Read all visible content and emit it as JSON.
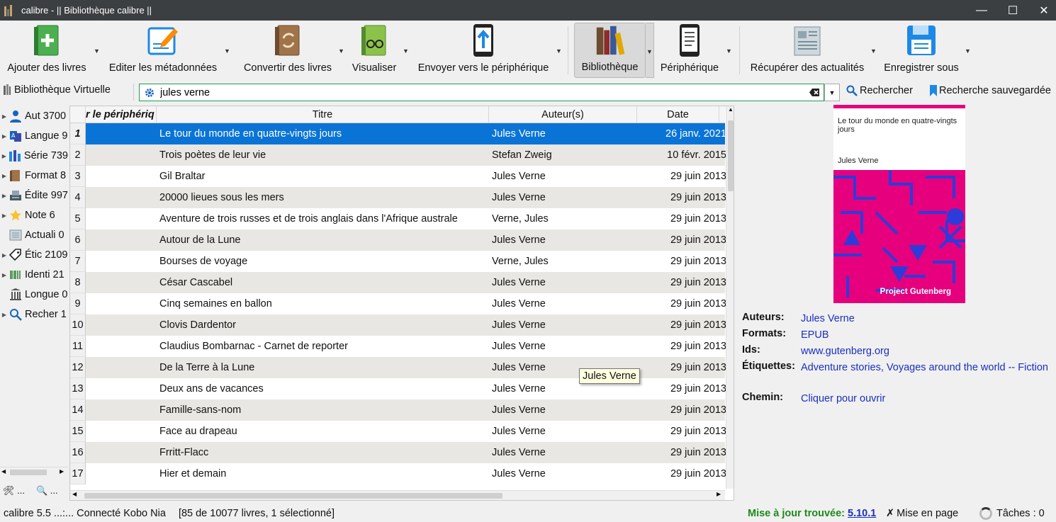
{
  "window": {
    "title": "calibre - || Bibliothèque calibre ||",
    "minimize": "—",
    "maximize": "☐",
    "close": "✕"
  },
  "toolbar": {
    "add_books": "Ajouter des livres",
    "edit_metadata": "Editer les métadonnées",
    "convert": "Convertir des livres",
    "view": "Visualiser",
    "send_device": "Envoyer vers le périphérique",
    "library": "Bibliothèque",
    "device": "Périphérique",
    "fetch_news": "Récupérer des actualités",
    "save_to_disk": "Enregistrer sous"
  },
  "searchbar": {
    "virtual_library": "Bibliothèque Virtuelle",
    "query": "jules verne",
    "search_button": "Rechercher",
    "saved_search": "Recherche sauvegardée"
  },
  "tag_browser": {
    "items": [
      {
        "label": "Aut 3700",
        "icon": "author-icon",
        "caret": true
      },
      {
        "label": "Langue 9",
        "icon": "language-icon",
        "caret": true
      },
      {
        "label": "Série 739",
        "icon": "series-icon",
        "caret": true
      },
      {
        "label": "Format 8",
        "icon": "format-icon",
        "caret": true
      },
      {
        "label": "Édite 997",
        "icon": "publisher-icon",
        "caret": true
      },
      {
        "label": "Note 6",
        "icon": "rating-star-icon",
        "caret": true
      },
      {
        "label": "Actuali 0",
        "icon": "news-icon",
        "caret": false
      },
      {
        "label": "Étic 2109",
        "icon": "tag-icon",
        "caret": true
      },
      {
        "label": "Identi 21",
        "icon": "identifier-barcode-icon",
        "caret": true
      },
      {
        "label": "Longue 0",
        "icon": "column-icon",
        "caret": false
      },
      {
        "label": "Recher 1",
        "icon": "search-icon",
        "caret": true
      }
    ],
    "tools_label": "...",
    "find_label": "..."
  },
  "booklist": {
    "columns": {
      "device": "r le périphériq",
      "title": "Titre",
      "authors": "Auteur(s)",
      "date": "Date"
    },
    "rows": [
      {
        "n": "1",
        "title": "Le tour du monde en quatre-vingts jours",
        "author": "Jules Verne",
        "date": "26 janv. 2021"
      },
      {
        "n": "2",
        "title": "Trois poètes de leur vie",
        "author": "Stefan Zweig",
        "date": "10 févr. 2015"
      },
      {
        "n": "3",
        "title": "Gil Braltar",
        "author": "Jules Verne",
        "date": "29 juin 2013"
      },
      {
        "n": "4",
        "title": "20000 lieues sous les mers",
        "author": "Jules Verne",
        "date": "29 juin 2013"
      },
      {
        "n": "5",
        "title": "Aventure de trois russes et de trois anglais dans l'Afrique australe",
        "author": "Verne, Jules",
        "date": "29 juin 2013"
      },
      {
        "n": "6",
        "title": "Autour de la Lune",
        "author": "Jules Verne",
        "date": "29 juin 2013"
      },
      {
        "n": "7",
        "title": "Bourses de voyage",
        "author": "Verne, Jules",
        "date": "29 juin 2013"
      },
      {
        "n": "8",
        "title": "César Cascabel",
        "author": "Jules Verne",
        "date": "29 juin 2013"
      },
      {
        "n": "9",
        "title": "Cinq semaines en ballon",
        "author": "Jules Verne",
        "date": "29 juin 2013"
      },
      {
        "n": "10",
        "title": "Clovis Dardentor",
        "author": "Jules Verne",
        "date": "29 juin 2013"
      },
      {
        "n": "11",
        "title": "Claudius Bombarnac - Carnet de reporter",
        "author": "Jules Verne",
        "date": "29 juin 2013"
      },
      {
        "n": "12",
        "title": "De la Terre à la Lune",
        "author": "Jules Verne",
        "date": "29 juin 2013"
      },
      {
        "n": "13",
        "title": "Deux ans de vacances",
        "author": "Jules Verne",
        "date": "29 juin 2013"
      },
      {
        "n": "14",
        "title": "Famille-sans-nom",
        "author": "Jules Verne",
        "date": "29 juin 2013"
      },
      {
        "n": "15",
        "title": "Face au drapeau",
        "author": "Jules Verne",
        "date": "29 juin 2013"
      },
      {
        "n": "16",
        "title": "Frritt-Flacc",
        "author": "Jules Verne",
        "date": "29 juin 2013"
      },
      {
        "n": "17",
        "title": "Hier et demain",
        "author": "Jules Verne",
        "date": "29 juin 2013"
      }
    ],
    "tooltip": "Jules Verne"
  },
  "details": {
    "cover": {
      "title": "Le tour du monde en quatre-vingts jours",
      "author": "Jules Verne",
      "publisher": "Project Gutenberg"
    },
    "authors_label": "Auteurs:",
    "authors": "Jules Verne",
    "formats_label": "Formats:",
    "formats": "EPUB",
    "ids_label": "Ids:",
    "ids": "www.gutenberg.org",
    "tags_label": "Étiquettes:",
    "tags": "Adventure stories, Voyages around the world -- Fiction",
    "path_label": "Chemin:",
    "path": "Cliquer pour ouvrir"
  },
  "status": {
    "left": "calibre 5.5 ...:... Connecté Kobo Nia",
    "count": "[85 de 10077 livres, 1 sélectionné]",
    "update_label": "Mise à jour trouvée:",
    "update_version": "5.10.1",
    "layout": "Mise en page",
    "jobs": "Tâches : 0"
  },
  "colors": {
    "selection": "#0a74d6",
    "alt_row": "#e9e7e3",
    "link": "#1a2fbf",
    "update_green": "#1c8a1c",
    "cover_pink": "#e6007e"
  }
}
